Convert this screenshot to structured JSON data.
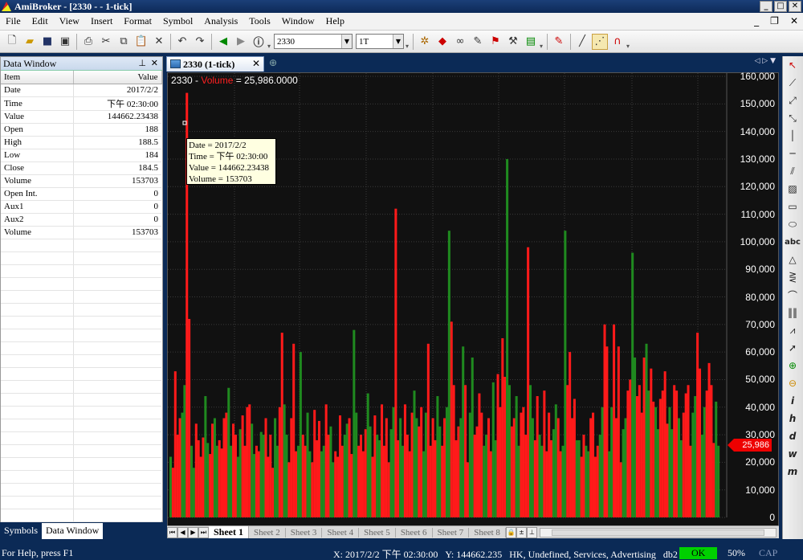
{
  "window": {
    "title": "AmiBroker - [2330 -  - 1-tick]",
    "controls": [
      "_",
      "□",
      "✕"
    ]
  },
  "menu": {
    "items": [
      "File",
      "Edit",
      "View",
      "Insert",
      "Format",
      "Symbol",
      "Analysis",
      "Tools",
      "Window",
      "Help"
    ],
    "mdi_controls": [
      "_",
      "❐",
      "✕"
    ]
  },
  "toolbar": {
    "symbol": "2330",
    "interval": "1T"
  },
  "data_window": {
    "title": "Data Window",
    "columns": [
      "Item",
      "Value"
    ],
    "rows": [
      {
        "item": "Date",
        "value": "2017/2/2"
      },
      {
        "item": "Time",
        "value": "下午 02:30:00"
      },
      {
        "item": "Value",
        "value": "144662.23438"
      },
      {
        "item": "Open",
        "value": "188"
      },
      {
        "item": "High",
        "value": "188.5"
      },
      {
        "item": "Low",
        "value": "184"
      },
      {
        "item": "Close",
        "value": "184.5"
      },
      {
        "item": "Volume",
        "value": "153703"
      },
      {
        "item": "Open Int.",
        "value": "0"
      },
      {
        "item": "Aux1",
        "value": "0"
      },
      {
        "item": "Aux2",
        "value": "0"
      },
      {
        "item": "Volume",
        "value": "153703"
      }
    ]
  },
  "bottom_tabs": [
    "Symbols",
    "Data Window"
  ],
  "chart_tab": {
    "label": "2330 (1-tick)"
  },
  "chart_legend": {
    "symbol": "2330",
    "sep": " - ",
    "indicator": "Volume",
    "value": " = 25,986.0000"
  },
  "tooltip": {
    "lines": [
      "Date = 2017/2/2",
      "Time = 下午 02:30:00",
      "Value = 144662.23438",
      "Volume = 153703"
    ]
  },
  "price_tag": "25,986",
  "sheets": [
    "Sheet 1",
    "Sheet 2",
    "Sheet 3",
    "Sheet 4",
    "Sheet 5",
    "Sheet 6",
    "Sheet 7",
    "Sheet 8"
  ],
  "chart_data": {
    "type": "bar",
    "title": "2330 - Volume = 25,986.0000",
    "ylim": [
      0,
      160000
    ],
    "yticks": [
      0,
      10000,
      20000,
      30000,
      40000,
      50000,
      60000,
      70000,
      80000,
      90000,
      100000,
      110000,
      120000,
      130000,
      140000,
      150000,
      160000
    ],
    "ytick_labels": [
      "0",
      "10,000",
      "20,000",
      "30,000",
      "40,000",
      "50,000",
      "60,000",
      "70,000",
      "80,000",
      "90,000",
      "100,000",
      "110,000",
      "120,000",
      "130,000",
      "140,000",
      "150,000",
      "160,000"
    ],
    "grid": true,
    "colors": {
      "up": "#1f8a1f",
      "down": "#ff1a1a",
      "background": "#111111"
    },
    "series": [
      {
        "values": [
          22000,
          18000,
          53000,
          30000,
          36000,
          38000,
          48000,
          154000,
          72000,
          26000,
          18000,
          34000,
          28000,
          22000,
          29000,
          44000,
          27000,
          23000,
          34000,
          36000,
          26000,
          28000,
          25000,
          36000,
          38000,
          47000,
          26000,
          34000,
          30000,
          22000,
          32000,
          37000,
          26000,
          40000,
          41000,
          34000,
          23000,
          26000,
          24000,
          31000,
          30000,
          36000,
          22000,
          30000,
          18000,
          36000,
          26000,
          40000,
          67000,
          41000,
          30000,
          20000,
          36000,
          63000,
          24000,
          26000,
          60000,
          30000,
          26000,
          38000,
          24000,
          20000,
          39000,
          28000,
          35000,
          24000,
          26000,
          41000,
          30000,
          33000,
          20000,
          24000,
          22000,
          37000,
          26000,
          30000,
          34000,
          36000,
          23000,
          68000,
          38000,
          26000,
          30000,
          24000,
          32000,
          45000,
          33000,
          22000,
          37000,
          30000,
          28000,
          41000,
          26000,
          36000,
          20000,
          32000,
          40000,
          112000,
          28000,
          36000,
          26000,
          41000,
          30000,
          24000,
          38000,
          46000,
          36000,
          33000,
          40000,
          24000,
          38000,
          63000,
          26000,
          36000,
          28000,
          44000,
          33000,
          26000,
          36000,
          40000,
          104000,
          71000,
          48000,
          28000,
          33000,
          36000,
          62000,
          48000,
          20000,
          38000,
          58000,
          30000,
          33000,
          45000,
          38000,
          26000,
          30000,
          36000,
          24000,
          49000,
          28000,
          52000,
          40000,
          65000,
          51000,
          130000,
          48000,
          33000,
          36000,
          44000,
          26000,
          38000,
          40000,
          30000,
          98000,
          48000,
          36000,
          28000,
          44000,
          30000,
          26000,
          46000,
          24000,
          38000,
          28000,
          32000,
          41000,
          36000,
          24000,
          26000,
          104000,
          48000,
          60000,
          36000,
          43000,
          28000,
          28000,
          22000,
          30000,
          26000,
          24000,
          36000,
          38000,
          22000,
          26000,
          30000,
          40000,
          70000,
          62000,
          24000,
          40000,
          70000,
          36000,
          62000,
          20000,
          32000,
          36000,
          46000,
          50000,
          96000,
          58000,
          44000,
          48000,
          38000,
          58000,
          63000,
          46000,
          54000,
          42000,
          40000,
          32000,
          43000,
          46000,
          53000,
          34000,
          40000,
          32000,
          48000,
          46000,
          36000,
          28000,
          38000,
          45000,
          48000,
          26000,
          38000,
          44000,
          67000,
          54000,
          30000,
          40000,
          46000,
          56000,
          48000,
          27000,
          42000,
          26000
        ]
      }
    ]
  }
}
